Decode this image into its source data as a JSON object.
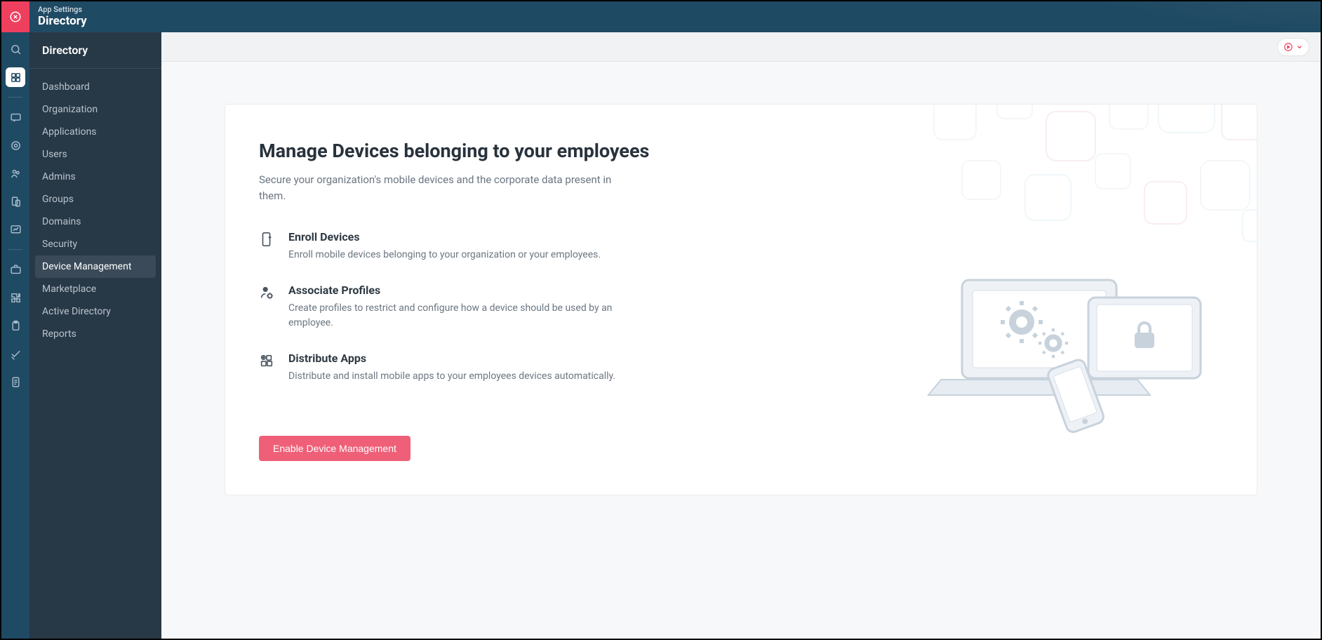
{
  "header": {
    "sub": "App Settings",
    "main": "Directory"
  },
  "iconrail": [
    {
      "name": "search-icon",
      "active": false
    },
    {
      "name": "apps-icon",
      "active": true
    },
    {
      "name": "chat-icon",
      "active": false
    },
    {
      "name": "location-icon",
      "active": false
    },
    {
      "name": "team-icon",
      "active": false
    },
    {
      "name": "device-icon",
      "active": false
    },
    {
      "name": "chart-icon",
      "active": false
    },
    {
      "name": "briefcase-icon",
      "active": false
    },
    {
      "name": "puzzle-icon",
      "active": false
    },
    {
      "name": "clipboard-icon",
      "active": false
    },
    {
      "name": "check-icon",
      "active": false
    },
    {
      "name": "doc-icon",
      "active": false
    }
  ],
  "secnav": {
    "title": "Directory",
    "items": [
      {
        "label": "Dashboard",
        "active": false
      },
      {
        "label": "Organization",
        "active": false
      },
      {
        "label": "Applications",
        "active": false
      },
      {
        "label": "Users",
        "active": false
      },
      {
        "label": "Admins",
        "active": false
      },
      {
        "label": "Groups",
        "active": false
      },
      {
        "label": "Domains",
        "active": false
      },
      {
        "label": "Security",
        "active": false
      },
      {
        "label": "Device Management",
        "active": true
      },
      {
        "label": "Marketplace",
        "active": false
      },
      {
        "label": "Active Directory",
        "active": false
      },
      {
        "label": "Reports",
        "active": false
      }
    ]
  },
  "page": {
    "title": "Manage Devices belonging to your employees",
    "subtitle": "Secure your organization's mobile devices and the corporate data present in them.",
    "features": [
      {
        "icon": "phone-plus-icon",
        "title": "Enroll Devices",
        "desc": "Enroll mobile devices belonging to your organization or your employees."
      },
      {
        "icon": "profile-gear-icon",
        "title": "Associate Profiles",
        "desc": "Create profiles to restrict and configure how a device should be used by an employee."
      },
      {
        "icon": "apps-plus-icon",
        "title": "Distribute Apps",
        "desc": "Distribute and install mobile apps to your employees devices automatically."
      }
    ],
    "cta": "Enable Device Management"
  },
  "colors": {
    "accent": "#ef3f5e",
    "header": "#1f4a63",
    "nav": "#273846"
  }
}
